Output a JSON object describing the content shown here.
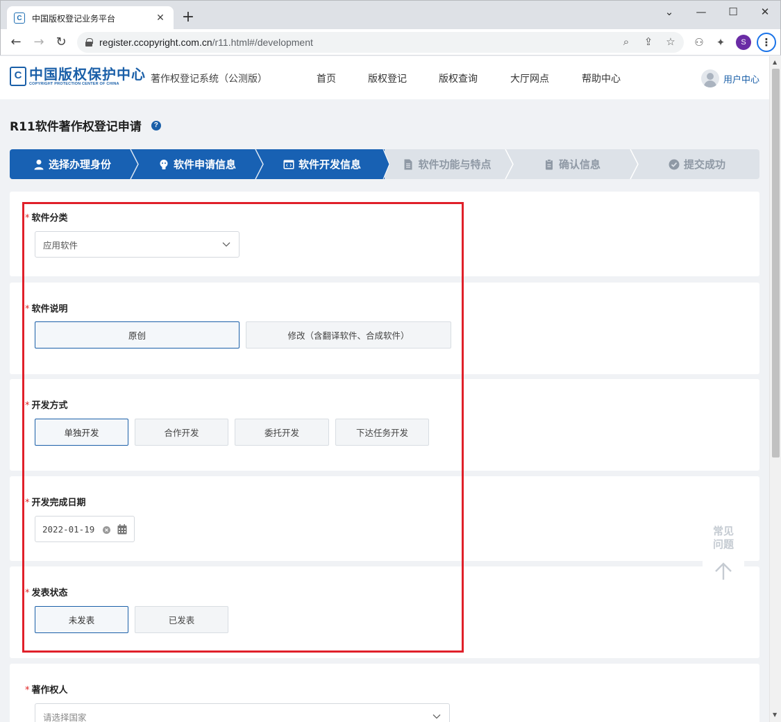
{
  "browser": {
    "tab_title": "中国版权登记业务平台",
    "favicon_letter": "C",
    "url_host": "register.ccopyright.com.cn",
    "url_path": "/r11.html#/development",
    "profile_letter": "S"
  },
  "header": {
    "logo_cn": "中国版权保护中心",
    "logo_en": "COPYRIGHT PROTECTION CENTER OF CHINA",
    "logo_mark": "C",
    "system_name": "著作权登记系统（公测版）",
    "nav": [
      "首页",
      "版权登记",
      "版权查询",
      "大厅网点",
      "帮助中心"
    ],
    "user_center": "用户中心"
  },
  "page": {
    "title": "R11软件著作权登记申请",
    "help_mark": "?"
  },
  "steps": [
    {
      "label": "选择办理身份",
      "state": "done",
      "icon": "user-icon"
    },
    {
      "label": "软件申请信息",
      "state": "done",
      "icon": "lightbulb-icon"
    },
    {
      "label": "软件开发信息",
      "state": "current",
      "icon": "code-window-icon"
    },
    {
      "label": "软件功能与特点",
      "state": "todo",
      "icon": "document-icon"
    },
    {
      "label": "确认信息",
      "state": "todo",
      "icon": "clipboard-icon"
    },
    {
      "label": "提交成功",
      "state": "todo",
      "icon": "check-circle-icon"
    }
  ],
  "form": {
    "required_mark": "*",
    "category": {
      "label": "软件分类",
      "value": "应用软件"
    },
    "description": {
      "label": "软件说明",
      "options": [
        "原创",
        "修改（含翻译软件、合成软件）"
      ],
      "selected": 0
    },
    "dev_method": {
      "label": "开发方式",
      "options": [
        "单独开发",
        "合作开发",
        "委托开发",
        "下达任务开发"
      ],
      "selected": 0
    },
    "completion_date": {
      "label": "开发完成日期",
      "value": "2022-01-19"
    },
    "publish_status": {
      "label": "发表状态",
      "options": [
        "未发表",
        "已发表"
      ],
      "selected": 0
    },
    "copyright_owner": {
      "label": "著作权人",
      "placeholder": "请选择国家"
    }
  },
  "faq": {
    "line1": "常见",
    "line2": "问题"
  },
  "colors": {
    "primary": "#1861b3",
    "highlight": "#e0202a",
    "required": "#e02020"
  }
}
